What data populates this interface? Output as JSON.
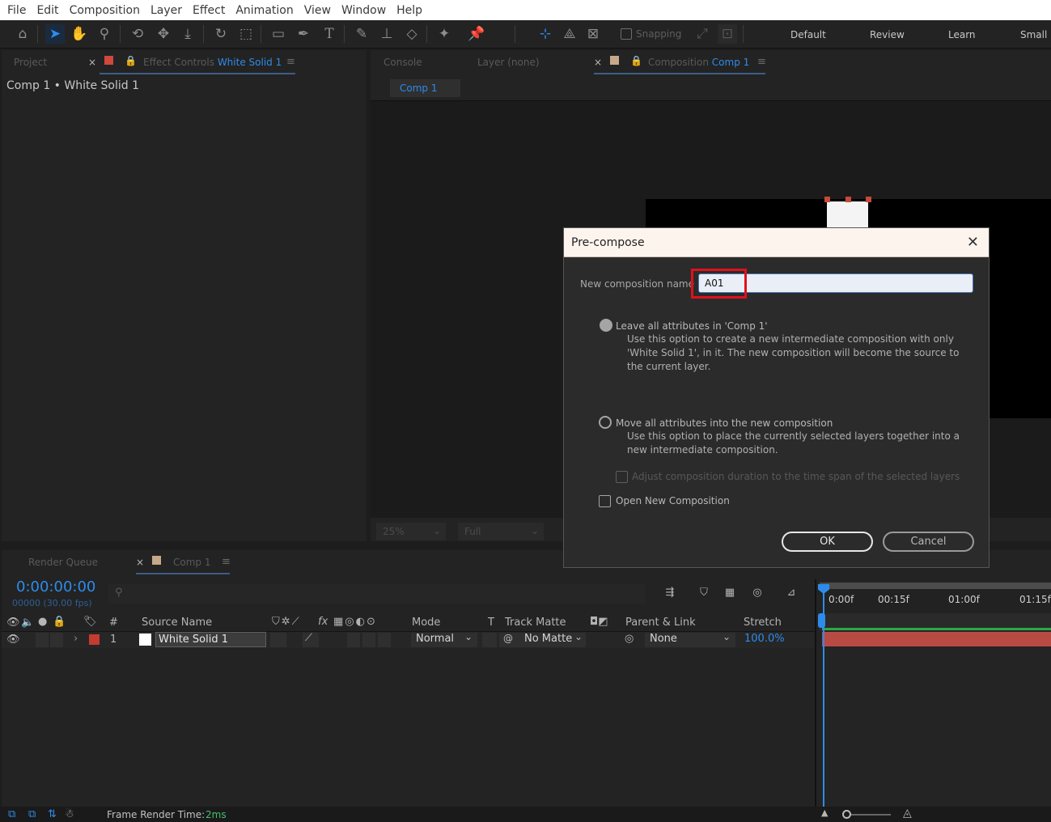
{
  "menu": [
    "File",
    "Edit",
    "Composition",
    "Layer",
    "Effect",
    "Animation",
    "View",
    "Window",
    "Help"
  ],
  "toolbar": {
    "snapping_label": "Snapping",
    "workspaces": [
      "Default",
      "Review",
      "Learn",
      "Small"
    ]
  },
  "left_panel": {
    "tab_project": "Project",
    "tab_effect_prefix": "Effect Controls",
    "tab_effect_layer": "White Solid 1",
    "breadcrumb": "Comp 1 • White Solid 1"
  },
  "viewer_panel": {
    "tab_console": "Console",
    "tab_layer": "Layer (none)",
    "tab_comp_prefix": "Composition",
    "tab_comp_name": "Comp 1",
    "subtab": "Comp 1",
    "zoom": "25%",
    "resolution": "Full"
  },
  "dialog": {
    "title": "Pre-compose",
    "name_label": "New composition name",
    "name_value": "A01",
    "option1_label": "Leave all attributes in 'Comp 1'",
    "option1_desc": "Use this option to create a new intermediate composition with only 'White Solid 1', in it. The new composition will become the source to the current layer.",
    "option2_label": "Move all attributes into the new composition",
    "option2_desc": "Use this option to place the currently selected layers together into a new intermediate composition.",
    "adjust_label": "Adjust composition duration to the time span of the selected layers",
    "open_label": "Open New Composition",
    "ok_label": "OK",
    "cancel_label": "Cancel"
  },
  "timeline": {
    "tab_render_queue": "Render Queue",
    "tab_comp": "Comp 1",
    "timecode": "0:00:00:00",
    "frames": "00000 (30.00 fps)",
    "ruler": [
      "0:00f",
      "00:15f",
      "01:00f",
      "01:15f"
    ],
    "columns": {
      "num": "#",
      "source_name": "Source Name",
      "mode": "Mode",
      "t": "T",
      "track_matte": "Track Matte",
      "parent_link": "Parent & Link",
      "stretch": "Stretch"
    },
    "layers": [
      {
        "num": "1",
        "name": "White Solid 1",
        "mode": "Normal",
        "matte": "No Matte",
        "parent": "None",
        "stretch": "100.0%"
      }
    ],
    "frame_render_label": "Frame Render Time:",
    "frame_render_value": "2ms"
  },
  "colors": {
    "accent_blue": "#2d8ceb",
    "highlight_red": "#e0101c",
    "layer_label_red": "#c53b30",
    "layer_bar": "#b84a44"
  }
}
